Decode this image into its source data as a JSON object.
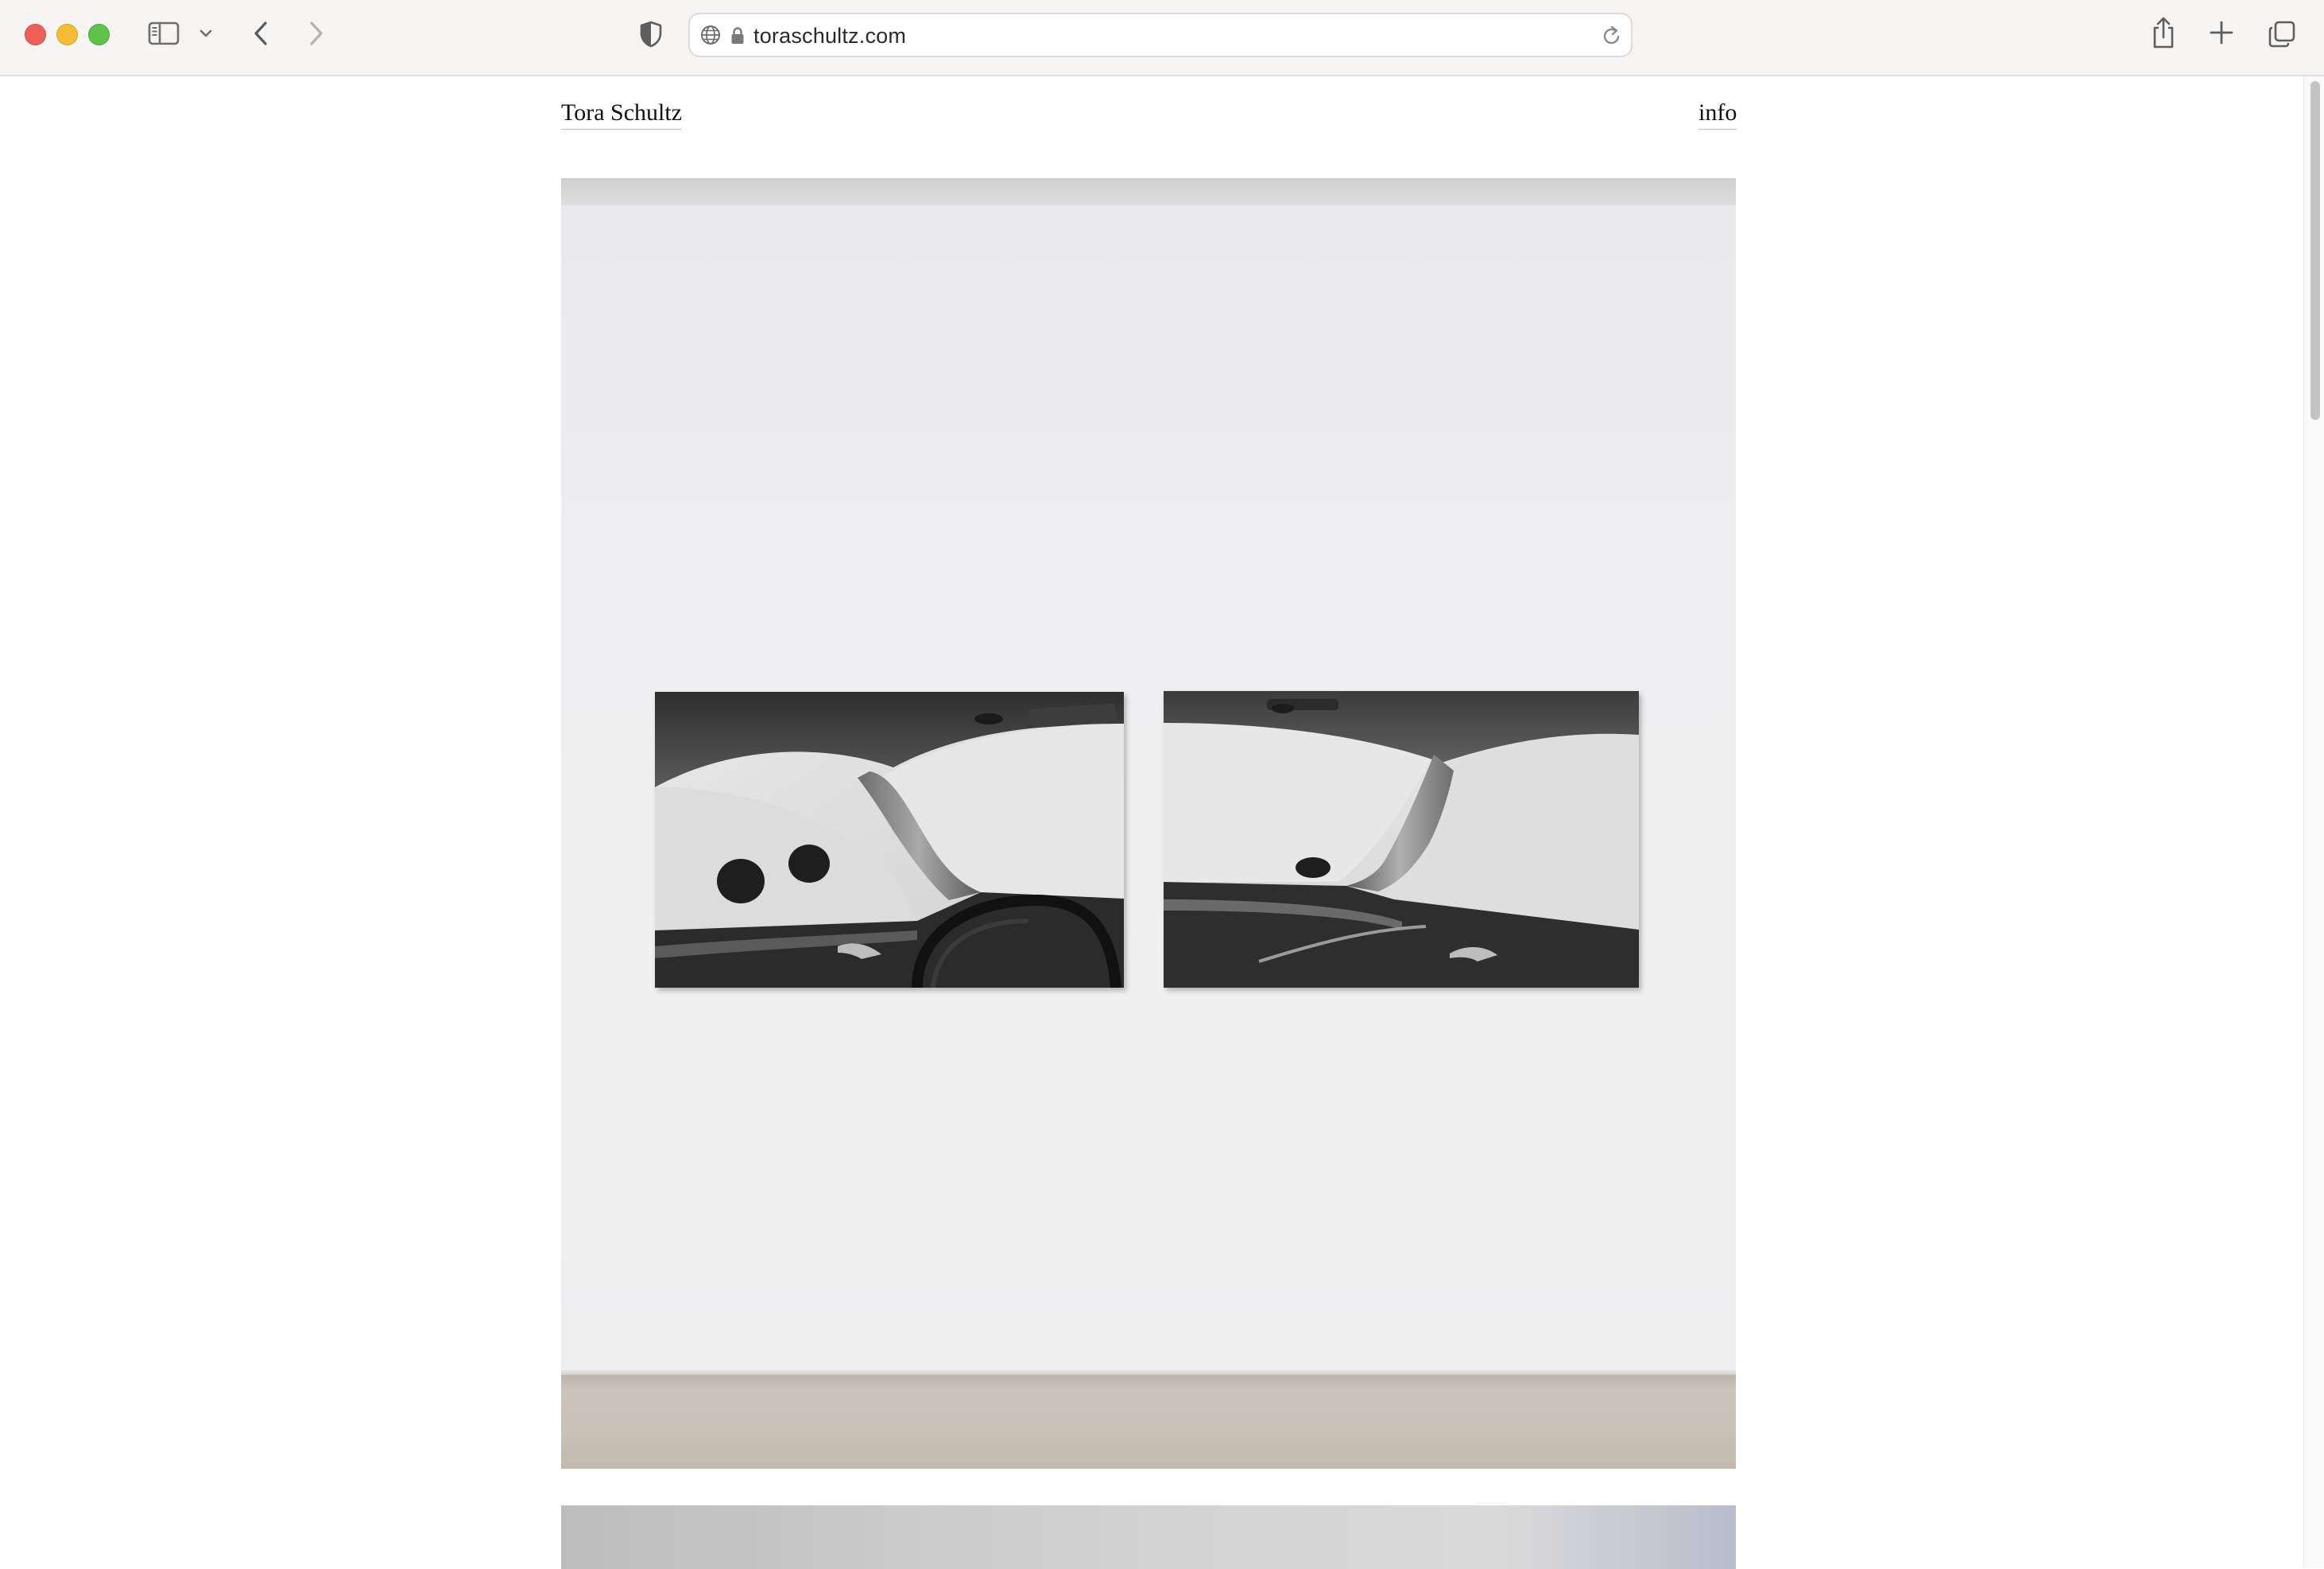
{
  "browser": {
    "url": "toraschultz.com",
    "icons": {
      "close": "close-dot",
      "minimize": "minimize-dot",
      "zoom": "zoom-dot",
      "sidebar": "sidebar-icon",
      "sidebar_menu": "chevron-down-icon",
      "back": "chevron-left-icon",
      "forward": "chevron-right-icon",
      "privacy": "shield-icon",
      "site": "globe-icon",
      "secure": "lock-icon",
      "reload": "reload-icon",
      "share": "share-icon",
      "new_tab": "plus-icon",
      "tabs": "tabs-overview-icon"
    }
  },
  "site": {
    "title": "Tora Schultz",
    "nav_info": "info"
  },
  "colors": {
    "chrome_bg": "#f6f5f4",
    "close": "#ee5f57",
    "minimize": "#f5bd30",
    "zoom": "#5ec447",
    "text": "#111111"
  }
}
